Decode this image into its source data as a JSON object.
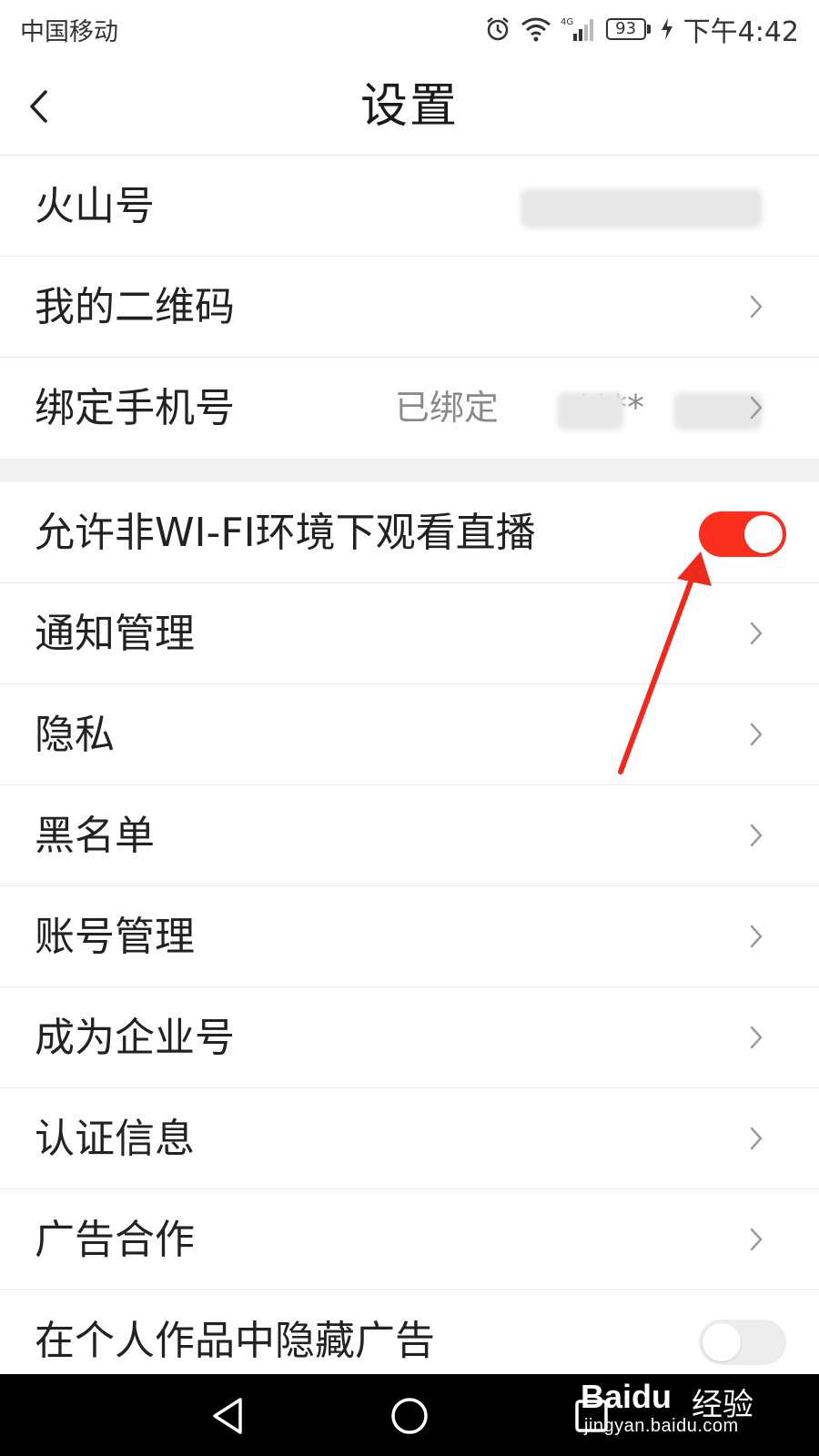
{
  "status_bar": {
    "carrier": "中国移动",
    "network": "4G",
    "battery": "93",
    "time": "下午4:42"
  },
  "header": {
    "title": "设置",
    "back_icon": "chevron-left-icon"
  },
  "settings": [
    {
      "label": "火山号",
      "value": "",
      "blurred": true,
      "control": "none"
    },
    {
      "label": "我的二维码",
      "control": "chevron"
    },
    {
      "label": "绑定手机号",
      "value": "已绑定 ",
      "masked": "****",
      "control": "chevron"
    },
    {
      "label": "允许非WI-FI环境下观看直播",
      "control": "toggle",
      "state": "on"
    },
    {
      "label": "通知管理",
      "control": "chevron"
    },
    {
      "label": "隐私",
      "control": "chevron"
    },
    {
      "label": "黑名单",
      "control": "chevron"
    },
    {
      "label": "账号管理",
      "control": "chevron"
    },
    {
      "label": "成为企业号",
      "control": "chevron"
    },
    {
      "label": "认证信息",
      "control": "chevron"
    },
    {
      "label": "广告合作",
      "control": "chevron"
    },
    {
      "label": "在个人作品中隐藏广告",
      "control": "toggle",
      "state": "off"
    }
  ],
  "colors": {
    "toggle_on": "#fb2f1d",
    "toggle_off": "#ececec",
    "annotation_arrow": "#f0291f"
  },
  "nav_bar": {
    "back_icon": "triangle-back-icon",
    "home_icon": "circle-home-icon",
    "recents_icon": "square-recents-icon"
  },
  "watermark": {
    "brand": "Baidu",
    "product": "经验",
    "url": "jingyan.baidu.com"
  }
}
